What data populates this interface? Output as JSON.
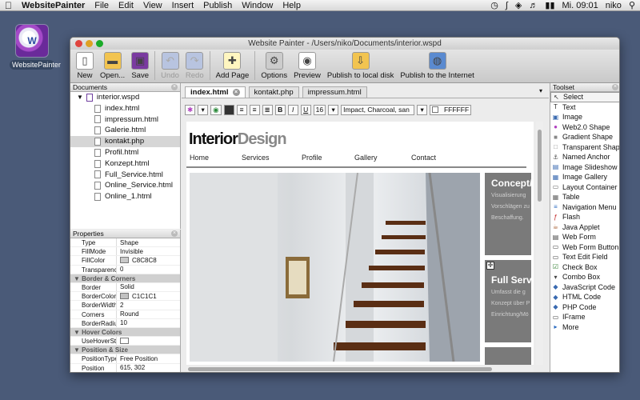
{
  "menubar": {
    "apple": "",
    "app_name": "WebsitePainter",
    "items": [
      "File",
      "Edit",
      "View",
      "Insert",
      "Publish",
      "Window",
      "Help"
    ],
    "clock": "Mi. 09:01",
    "user": "niko"
  },
  "desktop_icon": {
    "label": "WebsitePainter"
  },
  "window": {
    "title": "Website Painter - /Users/niko/Documents/interior.wspd"
  },
  "toolbar": [
    {
      "label": "New",
      "icon": "new-doc-icon",
      "enabled": true
    },
    {
      "label": "Open...",
      "icon": "folder-icon",
      "enabled": true
    },
    {
      "label": "Save",
      "icon": "save-icon",
      "enabled": true
    },
    {
      "label": "Undo",
      "icon": "undo-icon",
      "enabled": false
    },
    {
      "label": "Redo",
      "icon": "redo-icon",
      "enabled": false
    },
    {
      "label": "Add Page",
      "icon": "add-page-icon",
      "enabled": true
    },
    {
      "label": "Options",
      "icon": "gear-icon",
      "enabled": true
    },
    {
      "label": "Preview",
      "icon": "preview-icon",
      "enabled": true
    },
    {
      "label": "Publish to local disk",
      "icon": "publish-disk-icon",
      "enabled": true
    },
    {
      "label": "Publish to the Internet",
      "icon": "publish-internet-icon",
      "enabled": true
    }
  ],
  "documents": {
    "header": "Documents",
    "root": "interior.wspd",
    "files": [
      "index.html",
      "impressum.html",
      "Galerie.html",
      "kontakt.php",
      "Profil.html",
      "Konzept.html",
      "Full_Service.html",
      "Online_Service.html",
      "Online_1.html"
    ],
    "selected": "kontakt.php"
  },
  "properties": {
    "header": "Properties",
    "rows": [
      {
        "k": "Type",
        "v": "Shape"
      },
      {
        "k": "FillMode",
        "v": "Invisible"
      },
      {
        "k": "FillColor",
        "v": "C8C8C8",
        "swatch": "#c8c8c8"
      },
      {
        "k": "Transparency",
        "v": "0"
      },
      {
        "section": "Border & Corners"
      },
      {
        "k": "Border",
        "v": "Solid"
      },
      {
        "k": "BorderColor",
        "v": "C1C1C1",
        "swatch": "#c1c1c1"
      },
      {
        "k": "BorderWidth",
        "v": "2"
      },
      {
        "k": "Corners",
        "v": "Round"
      },
      {
        "k": "BorderRadius",
        "v": "10"
      },
      {
        "section": "Hover Colors"
      },
      {
        "k": "UseHoverStyles",
        "v": "",
        "checkbox": true
      },
      {
        "section": "Position & Size"
      },
      {
        "k": "PositionType",
        "v": "Free Position"
      },
      {
        "k": "Position",
        "v": "615, 302"
      }
    ]
  },
  "tabs": [
    {
      "label": "index.html",
      "active": true
    },
    {
      "label": "kontakt.php",
      "active": false
    },
    {
      "label": "impressum.html",
      "active": false
    }
  ],
  "format": {
    "font_size": "16",
    "font_family": "Impact, Charcoal, san",
    "color_value": "FFFFFF"
  },
  "site": {
    "logo_a": "Interior",
    "logo_b": "Design",
    "nav": [
      "Home",
      "Services",
      "Profile",
      "Gallery",
      "Contact"
    ],
    "box1_title": "Concept/",
    "box1_text": [
      "Visualisierung",
      "Vorschlägen zu",
      "Beschaffung."
    ],
    "box2_title": "Full Servi",
    "box2_text": [
      "Umfasst die g",
      "Konzept über P",
      "Einrichtung/Mö"
    ]
  },
  "toolset": {
    "header": "Toolset",
    "items": [
      {
        "label": "Select",
        "icon": "cursor-icon",
        "glyph": "↖",
        "color": "#333"
      },
      {
        "label": "Text",
        "icon": "text-icon",
        "glyph": "T",
        "color": "#333"
      },
      {
        "label": "Image",
        "icon": "image-icon",
        "glyph": "▣",
        "color": "#3a6ab0"
      },
      {
        "label": "Web2.0 Shape",
        "icon": "web2-shape-icon",
        "glyph": "●",
        "color": "#b040c0"
      },
      {
        "label": "Gradient Shape",
        "icon": "gradient-shape-icon",
        "glyph": "■",
        "color": "#888"
      },
      {
        "label": "Transparent Shape",
        "icon": "transparent-shape-icon",
        "glyph": "□",
        "color": "#888"
      },
      {
        "label": "Named Anchor",
        "icon": "anchor-icon",
        "glyph": "⚓",
        "color": "#555"
      },
      {
        "label": "Image Slideshow",
        "icon": "slideshow-icon",
        "glyph": "▤",
        "color": "#3a6ab0"
      },
      {
        "label": "Image Gallery",
        "icon": "gallery-icon",
        "glyph": "▦",
        "color": "#3a6ab0"
      },
      {
        "label": "Layout Container",
        "icon": "container-icon",
        "glyph": "▭",
        "color": "#666"
      },
      {
        "label": "Table",
        "icon": "table-icon",
        "glyph": "▦",
        "color": "#666"
      },
      {
        "label": "Navigation Menu",
        "icon": "nav-menu-icon",
        "glyph": "≡",
        "color": "#2a6ac0"
      },
      {
        "label": "Flash",
        "icon": "flash-icon",
        "glyph": "ƒ",
        "color": "#c02020"
      },
      {
        "label": "Java Applet",
        "icon": "java-icon",
        "glyph": "☕",
        "color": "#a05020"
      },
      {
        "label": "Web Form",
        "icon": "web-form-icon",
        "glyph": "▤",
        "color": "#444"
      },
      {
        "label": "Web Form Button",
        "icon": "form-button-icon",
        "glyph": "▭",
        "color": "#444"
      },
      {
        "label": "Text Edit Field",
        "icon": "text-field-icon",
        "glyph": "▭",
        "color": "#444"
      },
      {
        "label": "Check Box",
        "icon": "checkbox-icon",
        "glyph": "☑",
        "color": "#2a7a2a"
      },
      {
        "label": "Combo Box",
        "icon": "combo-box-icon",
        "glyph": "▾",
        "color": "#444"
      },
      {
        "label": "JavaScript Code",
        "icon": "js-icon",
        "glyph": "◆",
        "color": "#3a6ab0"
      },
      {
        "label": "HTML Code",
        "icon": "html-icon",
        "glyph": "◆",
        "color": "#3a6ab0"
      },
      {
        "label": "PHP Code",
        "icon": "php-icon",
        "glyph": "◆",
        "color": "#3a6ab0"
      },
      {
        "label": "IFrame",
        "icon": "iframe-icon",
        "glyph": "▭",
        "color": "#444"
      },
      {
        "label": "More",
        "icon": "more-icon",
        "glyph": "▸",
        "color": "#2a6ac0"
      }
    ],
    "selected": "Select"
  }
}
